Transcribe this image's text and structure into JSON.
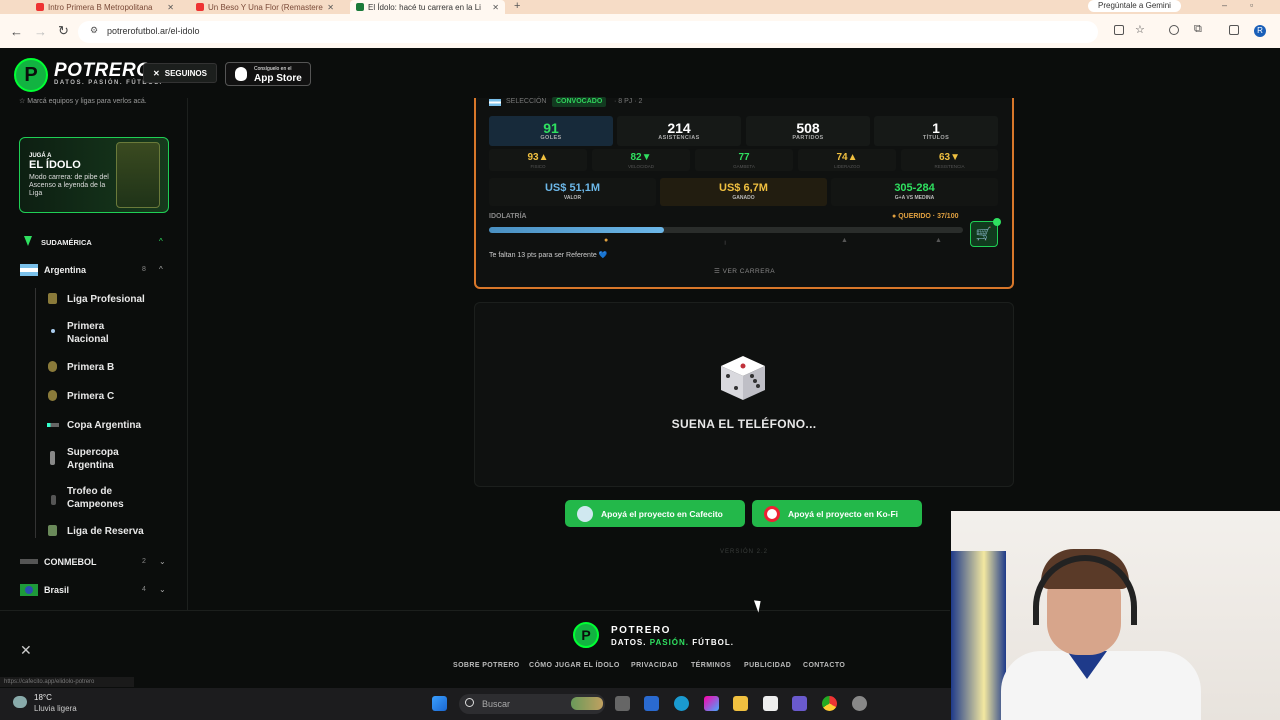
{
  "browser": {
    "tabs": [
      {
        "label": "Intro Primera B Metropolitana"
      },
      {
        "label": "Un Beso Y Una Flor (Remastere"
      },
      {
        "label": "El Ídolo: hacé tu carrera en la Li"
      }
    ],
    "url": "potrerofutbol.ar/el-idolo",
    "gemini_label": "Pregúntale a Gemini",
    "profile_initial": "R"
  },
  "header": {
    "logo_text": "POTRERO",
    "logo_tagline": "DATOS. PASIÓN. FÚTBOL.",
    "seguinos_label": "SEGUINOS",
    "appstore_small": "Consíguelo en el",
    "appstore_big": "App Store"
  },
  "sidebar": {
    "hint": "Marcá equipos y ligas para verlos acá.",
    "promo": {
      "line1": "JUGÁ A",
      "line2": "EL ÍDOLO",
      "line3": "Modo carrera: de pibe del Ascenso a leyenda de la Liga"
    },
    "region": {
      "label": "SUDAMÉRICA"
    },
    "country": {
      "label": "Argentina",
      "count": "8"
    },
    "leagues": [
      {
        "label": "Liga Profesional"
      },
      {
        "label": "Primera Nacional"
      },
      {
        "label": "Primera B"
      },
      {
        "label": "Primera C"
      },
      {
        "label": "Copa Argentina"
      },
      {
        "label": "Supercopa Argentina"
      },
      {
        "label": "Trofeo de Campeones"
      },
      {
        "label": "Liga de Reserva"
      }
    ],
    "conmebol": {
      "label": "CONMEBOL",
      "count": "2"
    },
    "brasil": {
      "label": "Brasil",
      "count": "4"
    }
  },
  "player_card": {
    "top_label": "SELECCIÓN",
    "convocado": "CONVOCADO",
    "top_meta": "· 8 PJ · 2",
    "stats": [
      {
        "value": "91",
        "label": "GOLES"
      },
      {
        "value": "214",
        "label": "ASISTENCIAS"
      },
      {
        "value": "508",
        "label": "PARTIDOS"
      },
      {
        "value": "1",
        "label": "TÍTULOS"
      }
    ],
    "attributes": [
      {
        "value": "93▲",
        "label": "FISICO",
        "color": "#f0c040"
      },
      {
        "value": "82▼",
        "label": "VELOCIDAD",
        "color": "#2fe060"
      },
      {
        "value": "77",
        "label": "GAMBETA",
        "color": "#2fe060"
      },
      {
        "value": "74▲",
        "label": "LIDERAZGO",
        "color": "#f0c040"
      },
      {
        "value": "63▼",
        "label": "RESISTENCIA",
        "color": "#f0c040"
      }
    ],
    "money": [
      {
        "value": "US$ 51,1M",
        "label": "VALOR",
        "color": "#6cb7e8"
      },
      {
        "value": "US$ 6,7M",
        "label": "GANADO",
        "color": "#f0c040"
      },
      {
        "value": "305-284",
        "label": "G+A VS MEDINA",
        "color": "#2fe060"
      }
    ],
    "idolatria_label": "IDOLATRÍA",
    "querido_label": "QUERIDO · 37/100",
    "idolatria_level": 0.37,
    "faltan_text": "Te faltan 13 pts para ser Referente 💙",
    "ver_carrera": "VER CARRERA",
    "cart_icon": "shopping-cart-icon"
  },
  "phone_panel": {
    "status": "SUENA EL TELÉFONO..."
  },
  "support": {
    "cafecito": "Apoyá el proyecto en Cafecito",
    "kofi": "Apoyá el proyecto en Ko-Fi"
  },
  "version": "VERSIÓN 2.2",
  "footer": {
    "logo_text": "POTRERO",
    "tag_1": "DATOS.",
    "tag_2": "PASIÓN.",
    "tag_3": "FÚTBOL.",
    "links": [
      {
        "label": "SOBRE POTRERO"
      },
      {
        "label": "CÓMO JUGAR EL ÍDOLO"
      },
      {
        "label": "PRIVACIDAD"
      },
      {
        "label": "TÉRMINOS"
      },
      {
        "label": "PUBLICIDAD"
      },
      {
        "label": "CONTACTO"
      }
    ],
    "status_url": "https://cafecito.app/elidolo-potrero"
  },
  "taskbar": {
    "temp": "18°C",
    "weather": "Lluvia ligera",
    "search_placeholder": "Buscar"
  }
}
